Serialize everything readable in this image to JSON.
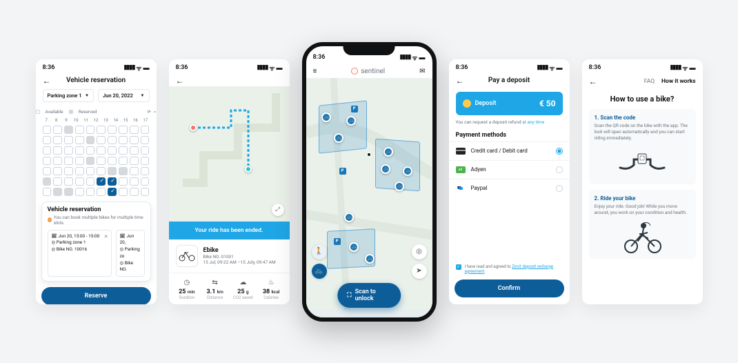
{
  "status": {
    "time": "8:36"
  },
  "s1": {
    "title": "Vehicle reservation",
    "zone": "Parking zone 1",
    "date": "Jun 20, 2022",
    "leg_avail": "Available",
    "leg_res": "Reserved",
    "days": [
      "7",
      "8",
      "9",
      "10",
      "11",
      "12",
      "13",
      "14",
      "15",
      "16",
      "17"
    ],
    "panel_title": "Vehicle reservation",
    "note": "You can book multiple bikes for multiple time slots.",
    "resv1_time": "Jun 20, 13:00 - 15:00",
    "resv1_zone": "Parking zone 1",
    "resv1_bike": "Bike NO. 10016",
    "resv2_time": "Jun 20,",
    "resv2_zone": "Parking zo",
    "resv2_bike": "Bike NO.",
    "btn": "Reserve"
  },
  "s2": {
    "banner": "Your ride has been ended.",
    "name": "Ebike",
    "no": "Bike NO. 01001",
    "when": "15 Jul, 09:22 AM –15 July, 09:47 AM",
    "d_val": "25",
    "d_unit": "min",
    "d_lbl": "Duration",
    "dist_val": "3.1",
    "dist_unit": "km",
    "dist_lbl": "Distance",
    "co2_val": "25",
    "co2_unit": "g",
    "co2_lbl": "CO2 saved",
    "cal_val": "38",
    "cal_unit": "kcal",
    "cal_lbl": "Calories"
  },
  "s3": {
    "brand": "sentinel",
    "scan": "Scan to unlock"
  },
  "s4": {
    "title": "Pay a deposit",
    "dep_label": "Deposit",
    "amount": "€ 50",
    "refund_a": "You can request a deposit refund",
    "refund_b": "at any time",
    "pm_title": "Payment methods",
    "pm_card": "Credit card / Debit card",
    "pm_adyen": "Adyen",
    "pm_pp": "Paypal",
    "agree_a": "I have read and agreed to",
    "agree_b": "Zimit deposit recharge agreement",
    "btn": "Confirm"
  },
  "s5": {
    "faq": "FAQ",
    "tab": "How it works",
    "title": "How to use a bike?",
    "step1_h": "1. Scan the code",
    "step1_t": "Scan the QR code on the bike with the app. The lock will open automatically and you can start riding immediately.",
    "step2_h": "2. Ride your bike",
    "step2_t": "Enjoy your ride. Good job! While you move around, you work on your condition and health."
  }
}
